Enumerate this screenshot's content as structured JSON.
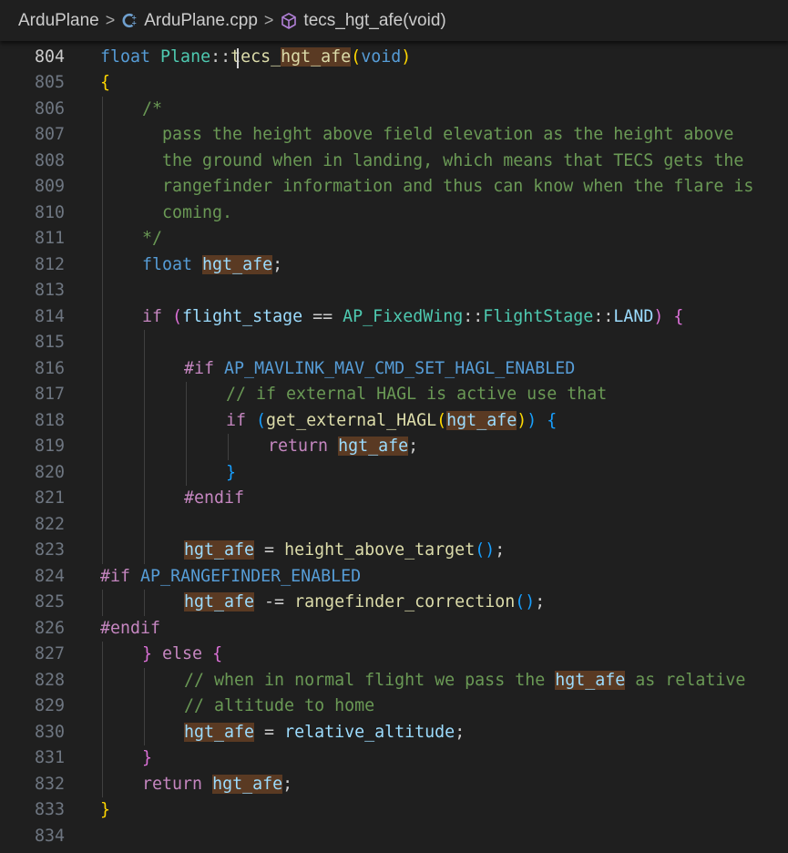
{
  "breadcrumb": {
    "items": [
      {
        "label": "ArduPlane",
        "icon": "none"
      },
      {
        "label": "ArduPlane.cpp",
        "icon": "cpp-file-icon"
      },
      {
        "label": "tecs_hgt_afe(void)",
        "icon": "method-cube-icon"
      }
    ],
    "separator": ">"
  },
  "editor": {
    "active_line": 804,
    "highlight_word": "hgt_afe",
    "lines": [
      {
        "n": 804,
        "indent": 0,
        "tokens": [
          [
            "kw",
            "float"
          ],
          [
            "",
            " "
          ],
          [
            "typ",
            "Plane"
          ],
          [
            "",
            "::"
          ],
          [
            "fn",
            "tecs_"
          ],
          [
            "fnhl",
            "hgt_afe"
          ],
          [
            "br1",
            "("
          ],
          [
            "kw",
            "void"
          ],
          [
            "br1",
            ")"
          ]
        ]
      },
      {
        "n": 805,
        "indent": 0,
        "tokens": [
          [
            "br1",
            "{"
          ]
        ]
      },
      {
        "n": 806,
        "indent": 1,
        "tokens": [
          [
            "cmt",
            "/*"
          ]
        ]
      },
      {
        "n": 807,
        "indent": 1,
        "tokens": [
          [
            "cmt",
            "  pass the height above field elevation as the height above"
          ]
        ]
      },
      {
        "n": 808,
        "indent": 1,
        "tokens": [
          [
            "cmt",
            "  the ground when in landing, which means that TECS gets the"
          ]
        ]
      },
      {
        "n": 809,
        "indent": 1,
        "tokens": [
          [
            "cmt",
            "  rangefinder information and thus can know when the flare is"
          ]
        ]
      },
      {
        "n": 810,
        "indent": 1,
        "tokens": [
          [
            "cmt",
            "  coming."
          ]
        ]
      },
      {
        "n": 811,
        "indent": 1,
        "tokens": [
          [
            "cmt",
            "*/"
          ]
        ]
      },
      {
        "n": 812,
        "indent": 1,
        "tokens": [
          [
            "kw",
            "float"
          ],
          [
            "",
            " "
          ],
          [
            "varhl",
            "hgt_afe"
          ],
          [
            "",
            ";"
          ]
        ]
      },
      {
        "n": 813,
        "indent": 1,
        "tokens": []
      },
      {
        "n": 814,
        "indent": 1,
        "tokens": [
          [
            "ctl",
            "if"
          ],
          [
            "",
            " "
          ],
          [
            "br2",
            "("
          ],
          [
            "var",
            "flight_stage"
          ],
          [
            "",
            " == "
          ],
          [
            "typ",
            "AP_FixedWing"
          ],
          [
            "",
            "::"
          ],
          [
            "typ",
            "FlightStage"
          ],
          [
            "",
            "::"
          ],
          [
            "var",
            "LAND"
          ],
          [
            "br2",
            ")"
          ],
          [
            "",
            " "
          ],
          [
            "br2",
            "{"
          ]
        ]
      },
      {
        "n": 815,
        "indent": 2,
        "tokens": []
      },
      {
        "n": 816,
        "indent": 2,
        "tokens": [
          [
            "ctl",
            "#if"
          ],
          [
            "",
            " "
          ],
          [
            "mac",
            "AP_MAVLINK_MAV_CMD_SET_HAGL_ENABLED"
          ]
        ]
      },
      {
        "n": 817,
        "indent": 3,
        "tokens": [
          [
            "cmt",
            "// if external HAGL is active use that"
          ]
        ]
      },
      {
        "n": 818,
        "indent": 3,
        "tokens": [
          [
            "ctl",
            "if"
          ],
          [
            "",
            " "
          ],
          [
            "br3",
            "("
          ],
          [
            "fn",
            "get_external_HAGL"
          ],
          [
            "br1",
            "("
          ],
          [
            "varhl",
            "hgt_afe"
          ],
          [
            "br1",
            ")"
          ],
          [
            "br3",
            ")"
          ],
          [
            "",
            " "
          ],
          [
            "br3",
            "{"
          ]
        ]
      },
      {
        "n": 819,
        "indent": 4,
        "tokens": [
          [
            "ctl",
            "return"
          ],
          [
            "",
            " "
          ],
          [
            "varhl",
            "hgt_afe"
          ],
          [
            "",
            ";"
          ]
        ]
      },
      {
        "n": 820,
        "indent": 3,
        "tokens": [
          [
            "br3",
            "}"
          ]
        ]
      },
      {
        "n": 821,
        "indent": 2,
        "tokens": [
          [
            "ctl",
            "#endif"
          ]
        ]
      },
      {
        "n": 822,
        "indent": 2,
        "tokens": []
      },
      {
        "n": 823,
        "indent": 2,
        "tokens": [
          [
            "varhl",
            "hgt_afe"
          ],
          [
            "",
            " = "
          ],
          [
            "fn",
            "height_above_target"
          ],
          [
            "br3",
            "()"
          ],
          [
            "",
            ";"
          ]
        ]
      },
      {
        "n": 824,
        "indent": 0,
        "tokens": [
          [
            "ctl",
            "#if"
          ],
          [
            "",
            " "
          ],
          [
            "mac",
            "AP_RANGEFINDER_ENABLED"
          ]
        ]
      },
      {
        "n": 825,
        "indent": 2,
        "tokens": [
          [
            "varhl",
            "hgt_afe"
          ],
          [
            "",
            " -= "
          ],
          [
            "fn",
            "rangefinder_correction"
          ],
          [
            "br3",
            "()"
          ],
          [
            "",
            ";"
          ]
        ]
      },
      {
        "n": 826,
        "indent": 0,
        "tokens": [
          [
            "ctl",
            "#endif"
          ]
        ]
      },
      {
        "n": 827,
        "indent": 1,
        "tokens": [
          [
            "br2",
            "}"
          ],
          [
            "",
            " "
          ],
          [
            "ctl",
            "else"
          ],
          [
            "",
            " "
          ],
          [
            "br2",
            "{"
          ]
        ]
      },
      {
        "n": 828,
        "indent": 2,
        "tokens": [
          [
            "cmt",
            "// when in normal flight we pass the "
          ],
          [
            "cmthl",
            "hgt_afe"
          ],
          [
            "cmt",
            " as relative"
          ]
        ]
      },
      {
        "n": 829,
        "indent": 2,
        "tokens": [
          [
            "cmt",
            "// altitude to home"
          ]
        ]
      },
      {
        "n": 830,
        "indent": 2,
        "tokens": [
          [
            "varhl",
            "hgt_afe"
          ],
          [
            "",
            " = "
          ],
          [
            "var",
            "relative_altitude"
          ],
          [
            "",
            ";"
          ]
        ]
      },
      {
        "n": 831,
        "indent": 1,
        "tokens": [
          [
            "br2",
            "}"
          ]
        ]
      },
      {
        "n": 832,
        "indent": 1,
        "tokens": [
          [
            "ctl",
            "return"
          ],
          [
            "",
            " "
          ],
          [
            "varhl",
            "hgt_afe"
          ],
          [
            "",
            ";"
          ]
        ]
      },
      {
        "n": 833,
        "indent": 0,
        "tokens": [
          [
            "br1",
            "}"
          ]
        ]
      },
      {
        "n": 834,
        "indent": 0,
        "tokens": []
      }
    ]
  }
}
